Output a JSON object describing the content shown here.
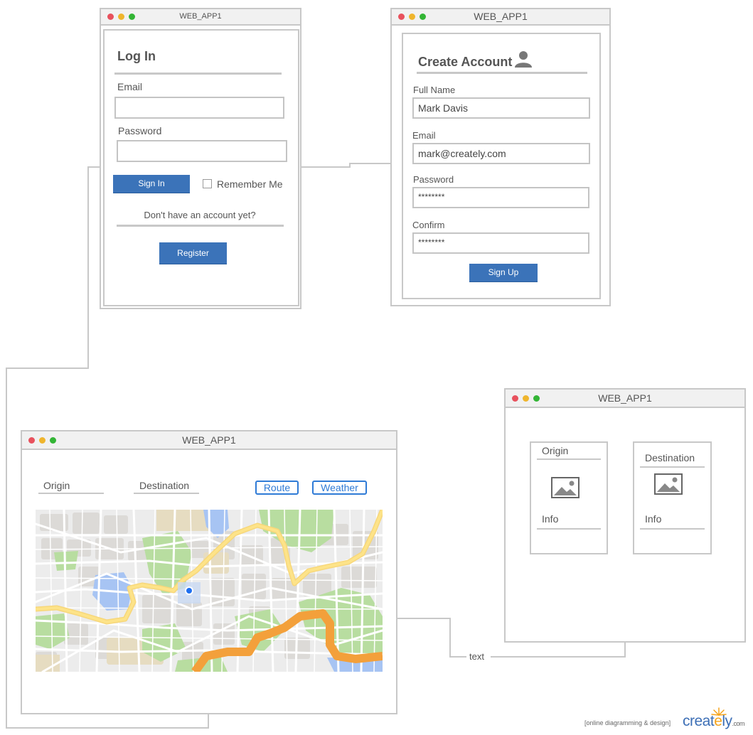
{
  "login_window": {
    "title": "WEB_APP1",
    "heading": "Log In",
    "email_label": "Email",
    "email_value": "",
    "password_label": "Password",
    "password_value": "",
    "sign_in_label": "Sign In",
    "remember_label": "Remember Me",
    "remember_checked": false,
    "no_account_text": "Don't have an account yet?",
    "register_label": "Register"
  },
  "create_window": {
    "title": "WEB_APP1",
    "heading": "Create Account",
    "fullname_label": "Full Name",
    "fullname_value": "Mark Davis",
    "email_label": "Email",
    "email_value": "mark@creately.com",
    "password_label": "Password",
    "password_value": "********",
    "confirm_label": "Confirm",
    "confirm_value": "********",
    "signup_label": "Sign Up"
  },
  "map_window": {
    "title": "WEB_APP1",
    "origin_label": "Origin",
    "destination_label": "Destination",
    "route_label": "Route",
    "weather_label": "Weather"
  },
  "detail_window": {
    "title": "WEB_APP1",
    "card1_heading": "Origin",
    "card1_info": "Info",
    "card2_heading": "Destination",
    "card2_info": "Info"
  },
  "connector_label": "text",
  "footer": {
    "tagline": "[online diagramming & design]",
    "brand_prefix": "creat",
    "brand_highlight": "e",
    "brand_suffix": "ly",
    "brand_domain": ".com"
  },
  "colors": {
    "window_border": "#c8c8c8",
    "button_blue": "#3b73b9",
    "outline_button_blue": "#2f7bd6",
    "dot_red": "#e8515d",
    "dot_yellow": "#efb52d",
    "dot_green": "#33b535",
    "brand_blue": "#3d6fb6",
    "brand_orange": "#f5a31a"
  }
}
